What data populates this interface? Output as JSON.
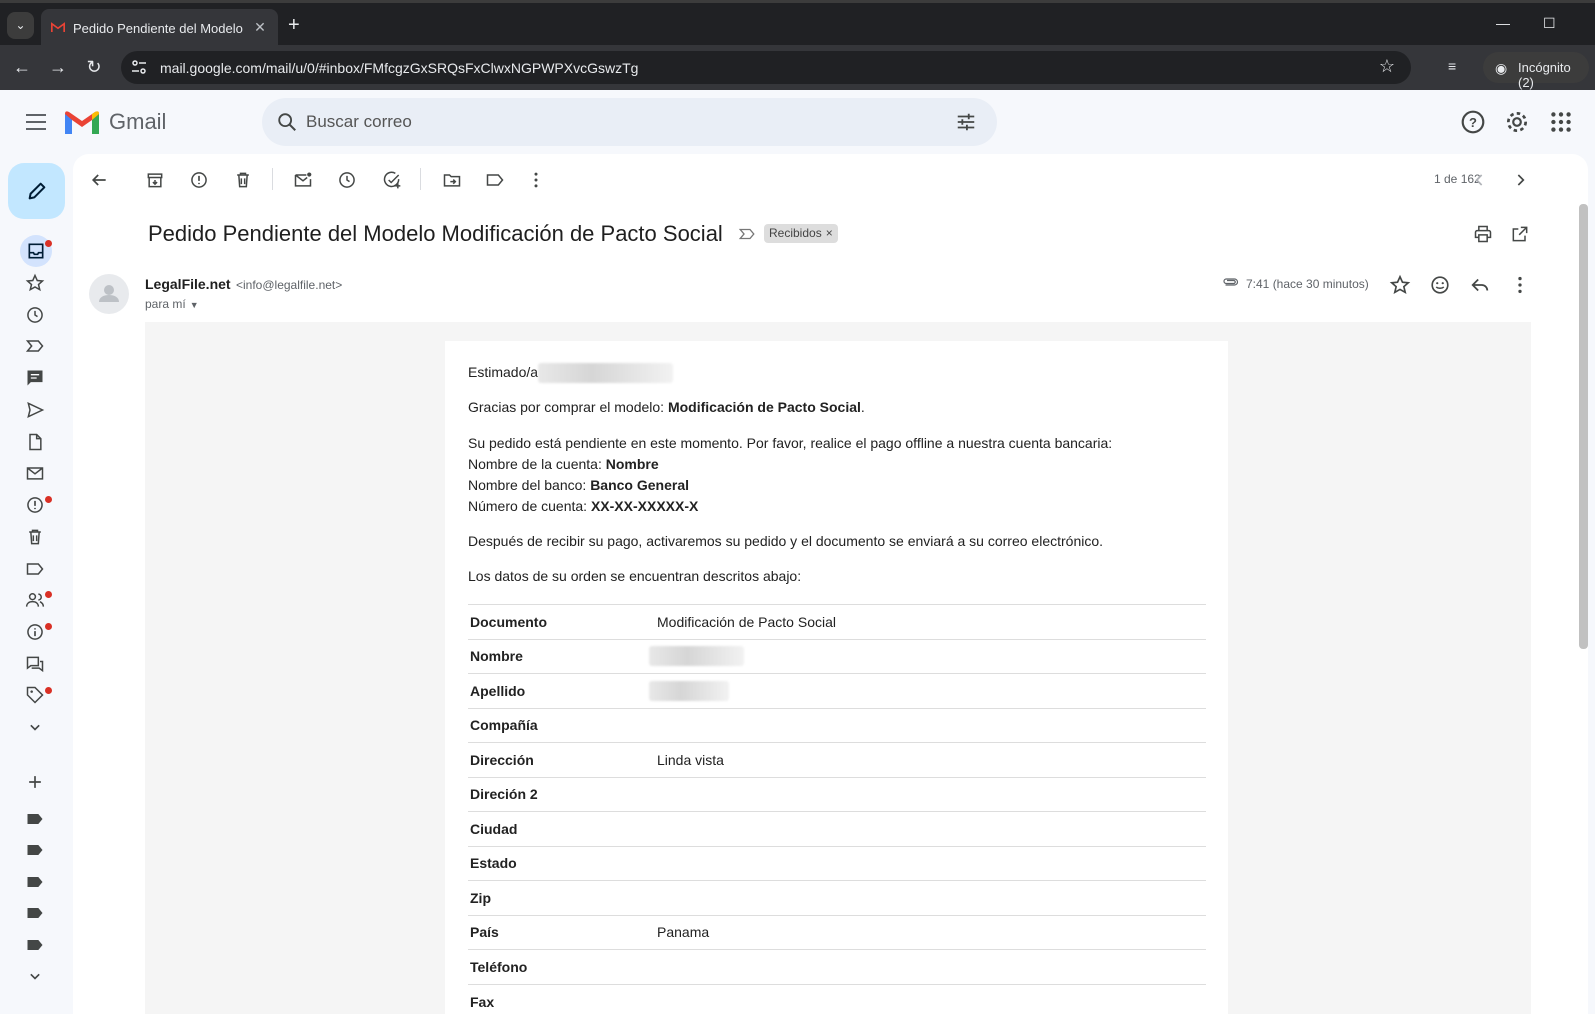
{
  "browser": {
    "tab_title": "Pedido Pendiente del Modelo M",
    "url": "mail.google.com/mail/u/0/#inbox/FMfcgzGxSRQsFxClwxNGPWPXvcGswzTg",
    "incognito_label": "Incógnito (2)"
  },
  "gmail": {
    "logo_text": "Gmail",
    "search_placeholder": "Buscar correo",
    "pager": "1 de 162"
  },
  "message": {
    "subject": "Pedido Pendiente del Modelo Modificación de Pacto Social",
    "label_chip": "Recibidos",
    "sender_name": "LegalFile.net",
    "sender_email": "<info@legalfile.net>",
    "to": "para mí",
    "time": "7:41 (hace 30 minutos)"
  },
  "body": {
    "greeting": "Estimado/a",
    "thanks_prefix": "Gracias por comprar el modelo: ",
    "thanks_model": "Modificación de Pacto Social",
    "thanks_suffix": ".",
    "pending": "Su pedido está pendiente en este momento. Por favor, realice el pago offline a nuestra cuenta bancaria:",
    "account_name_label": "Nombre de la cuenta: ",
    "account_name_value": "Nombre",
    "bank_label": "Nombre del banco: ",
    "bank_value": "Banco General",
    "acct_num_label": "Número de cuenta: ",
    "acct_num_value": "XX-XX-XXXXX-X",
    "after_payment": "Después de recibir su pago, activaremos su pedido y el documento se enviará a su correo electrónico.",
    "order_intro": "Los datos de su orden se encuentran descritos abajo:"
  },
  "order_table": [
    {
      "key": "Documento",
      "value": "Modificación de Pacto Social"
    },
    {
      "key": "Nombre",
      "value": "",
      "redacted": true
    },
    {
      "key": "Apellido",
      "value": "",
      "redacted": true
    },
    {
      "key": "Compañía",
      "value": ""
    },
    {
      "key": "Dirección",
      "value": "Linda vista"
    },
    {
      "key": "Direción 2",
      "value": ""
    },
    {
      "key": "Ciudad",
      "value": ""
    },
    {
      "key": "Estado",
      "value": ""
    },
    {
      "key": "Zip",
      "value": ""
    },
    {
      "key": "País",
      "value": "Panama"
    },
    {
      "key": "Teléfono",
      "value": ""
    },
    {
      "key": "Fax",
      "value": ""
    }
  ],
  "icons": {
    "rail": [
      "inbox-icon",
      "star-icon",
      "clock-icon",
      "important-icon",
      "chat-icon",
      "send-icon",
      "draft-icon",
      "all-mail-icon",
      "spam-icon",
      "trash-icon",
      "label-icon",
      "people-icon",
      "info-icon",
      "forum-icon",
      "tag-icon",
      "expand-icon"
    ],
    "accent": "#c2e7ff",
    "alert_dot": "#d93025"
  }
}
